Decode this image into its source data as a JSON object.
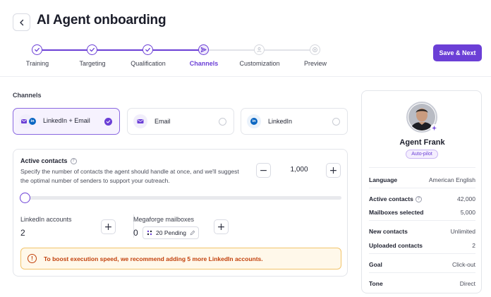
{
  "header": {
    "title": "AI Agent onboarding",
    "save_label": "Save & Next"
  },
  "steps": [
    {
      "label": "Training",
      "state": "done",
      "icon": "check-icon"
    },
    {
      "label": "Targeting",
      "state": "done",
      "icon": "check-icon"
    },
    {
      "label": "Qualification",
      "state": "done",
      "icon": "check-icon"
    },
    {
      "label": "Channels",
      "state": "active",
      "icon": "send-icon"
    },
    {
      "label": "Customization",
      "state": "todo",
      "icon": "sliders-icon"
    },
    {
      "label": "Preview",
      "state": "todo",
      "icon": "eye-icon"
    }
  ],
  "channels": {
    "section_label": "Channels",
    "options": [
      {
        "label": "LinkedIn + Email",
        "selected": true
      },
      {
        "label": "Email",
        "selected": false
      },
      {
        "label": "LinkedIn",
        "selected": false
      }
    ]
  },
  "active_contacts": {
    "title": "Active contacts",
    "help": "?",
    "description": "Specify the number of contacts the agent should handle at once, and we'll suggest the optimal number of senders to support your outreach.",
    "value": "1,000",
    "minus": "−",
    "plus": "+",
    "slider_level": 0
  },
  "linkedin_accounts": {
    "label": "LinkedIn accounts",
    "value": "2",
    "plus": "+"
  },
  "mailboxes": {
    "label": "Megaforge mailboxes",
    "value": "0",
    "pending": "20 Pending",
    "plus": "+"
  },
  "alert": {
    "icon": "!",
    "text": "To boost execution speed, we recommend adding 5 more LinkedIn accounts."
  },
  "agent": {
    "name": "Agent Frank",
    "badge": "Auto-pilot",
    "rows": [
      {
        "key": "Language",
        "value": "American English"
      },
      {
        "key": "Active contacts",
        "value": "42,000",
        "help": "?"
      },
      {
        "key": "Mailboxes selected",
        "value": "5,000"
      },
      {
        "key": "New contacts",
        "value": "Unlimited"
      },
      {
        "key": "Uploaded contacts",
        "value": "2"
      },
      {
        "key": "Goal",
        "value": "Click-out"
      },
      {
        "key": "Tone",
        "value": "Direct"
      }
    ]
  },
  "colors": {
    "accent": "#6b3fd6",
    "warning": "#c2410c",
    "linkedin": "#0a66c2"
  }
}
